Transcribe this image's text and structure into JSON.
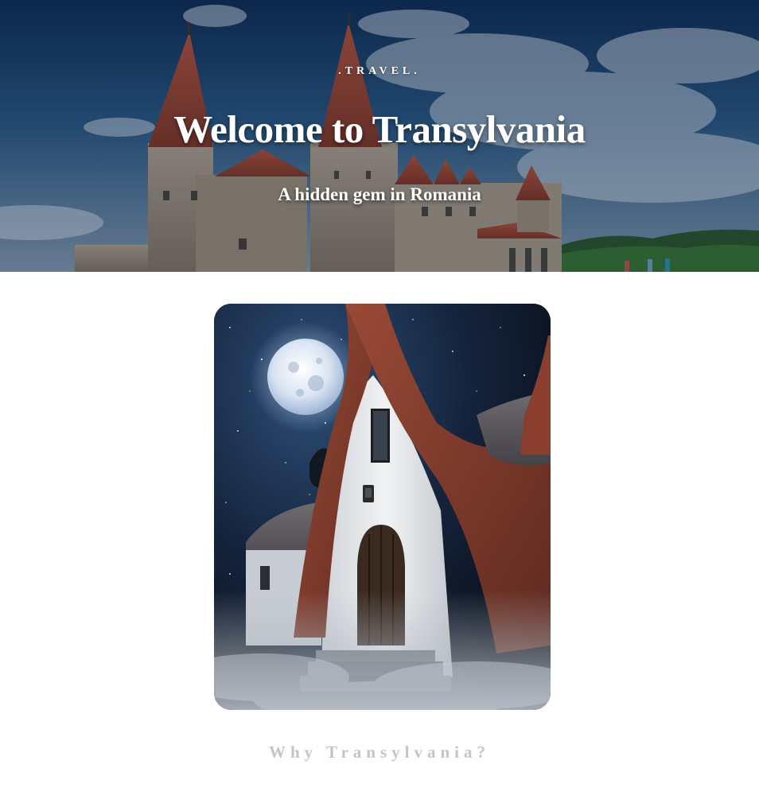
{
  "hero": {
    "kicker": ".TRAVEL.",
    "title": "Welcome to Transylvania",
    "subtitle": "A hidden gem in Romania",
    "image": "hunyad-castle-photo"
  },
  "feature": {
    "image": "clay-castle-night-photo"
  },
  "section": {
    "heading": "Why Transylvania?"
  },
  "colors": {
    "hero_text": "#ffffff",
    "section_heading": "#c3c3cc",
    "background": "#ffffff"
  }
}
